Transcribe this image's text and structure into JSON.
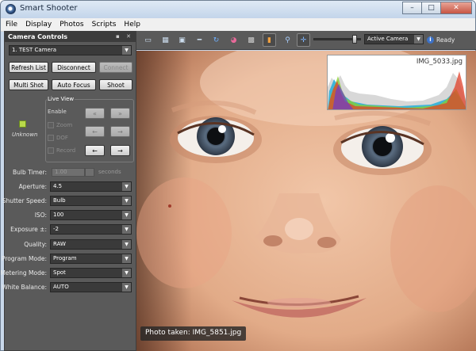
{
  "window": {
    "title": "Smart Shooter",
    "controls": {
      "minimize": "–",
      "maximize": "□",
      "close": "✕"
    }
  },
  "menu": [
    "File",
    "Display",
    "Photos",
    "Scripts",
    "Help"
  ],
  "panel": {
    "title": "Camera Controls",
    "camera_select": "1. TEST Camera",
    "buttons": {
      "refresh": "Refresh List",
      "disconnect": "Disconnect",
      "connect": "Connect",
      "multi_shot": "Multi Shot",
      "auto_focus": "Auto Focus",
      "shoot": "Shoot"
    },
    "status_label": "Unknown",
    "live_view": {
      "title": "Live View",
      "enable": "Enable",
      "zoom": "Zoom",
      "dof": "DOF",
      "record": "Record",
      "arrows": {
        "far_left": "«",
        "far_right": "»",
        "left": "←",
        "right": "→",
        "left2": "←",
        "right2": "→"
      }
    },
    "bulb": {
      "label": "Bulb Timer:",
      "value": "1.00",
      "unit": "seconds"
    },
    "settings": [
      {
        "label": "Aperture:",
        "value": "4.5"
      },
      {
        "label": "Shutter Speed:",
        "value": "Bulb"
      },
      {
        "label": "ISO:",
        "value": "100"
      },
      {
        "label": "Exposure ±:",
        "value": "-2"
      },
      {
        "label": "Quality:",
        "value": "RAW"
      },
      {
        "label": "Program Mode:",
        "value": "Program"
      },
      {
        "label": "Metering Mode:",
        "value": "Spot"
      },
      {
        "label": "White Balance:",
        "value": "AUTO"
      }
    ]
  },
  "toolbar": {
    "icons": [
      "monitor-icon",
      "grid-view-icon",
      "single-view-icon",
      "minus-icon",
      "refresh-icon",
      "color-wheel-icon",
      "grid-overlay-icon",
      "histogram-icon",
      "magnifier-icon",
      "focus-target-icon"
    ],
    "camera_filter": "Active Camera",
    "status": "Ready",
    "zoom_level": 0.8
  },
  "histogram": {
    "filename": "IMG_5033.jpg"
  },
  "photo": {
    "caption": "Photo taken: IMG_5851.jpg"
  },
  "colors": {
    "panel_bg": "#5a5a5a",
    "panel_header": "#3c3c3c",
    "titlebar": "#c9d8ea",
    "accent": "#3c72c8"
  }
}
